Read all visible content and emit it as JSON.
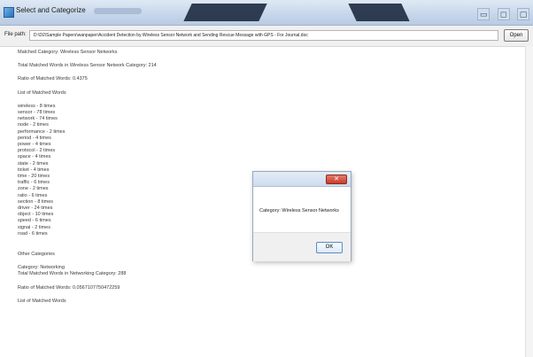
{
  "window": {
    "title": "Select and Categorize",
    "controls": {
      "minimize": "▭",
      "maximize": "◻",
      "close": "▢"
    }
  },
  "pathbar": {
    "label": "File path:",
    "value": "D:\\D2\\Sample Papers\\wanpaper\\Accident Detection by Wireless Sensor Network and Sending Rescue Message with GPS - For Journal.doc",
    "open_button": "Open"
  },
  "content": {
    "matched_category": "Matched Category: Wireless Sensor Networks",
    "total_words": "Total Matched Words in Wireless Sensor Network Category: 214",
    "ratio": "Ratio of Matched Words: 0.4375",
    "list_header": "List of Matched Words",
    "words": [
      "wireless - 8 times",
      "sensor - 78 times",
      "network - 74 times",
      "node - 2 times",
      "performance - 2 times",
      "period - 4 times",
      "power - 4 times",
      "protocol - 2 times",
      "space - 4 times",
      "state - 2 times",
      "ticket - 4 times",
      "time - 20 times",
      "traffic - 6 times",
      "zone - 2 times",
      "ratio - 6 times",
      "section - 8 times",
      "driver - 24 times",
      "object - 10 times",
      "speed - 6 times",
      "signal - 2 times",
      "road - 6 times"
    ],
    "other_header": "Other Categories",
    "other_category": "Category: Networking",
    "other_total": "Total Matched Words in Networking Category: 288",
    "other_ratio": "Ratio of Matched Words: 0.0567107750472259",
    "other_list_header": "List of Matched Words"
  },
  "dialog": {
    "close_symbol": "✕",
    "message": "Category: Wireless Sensor Networks",
    "ok_label": "OK"
  }
}
